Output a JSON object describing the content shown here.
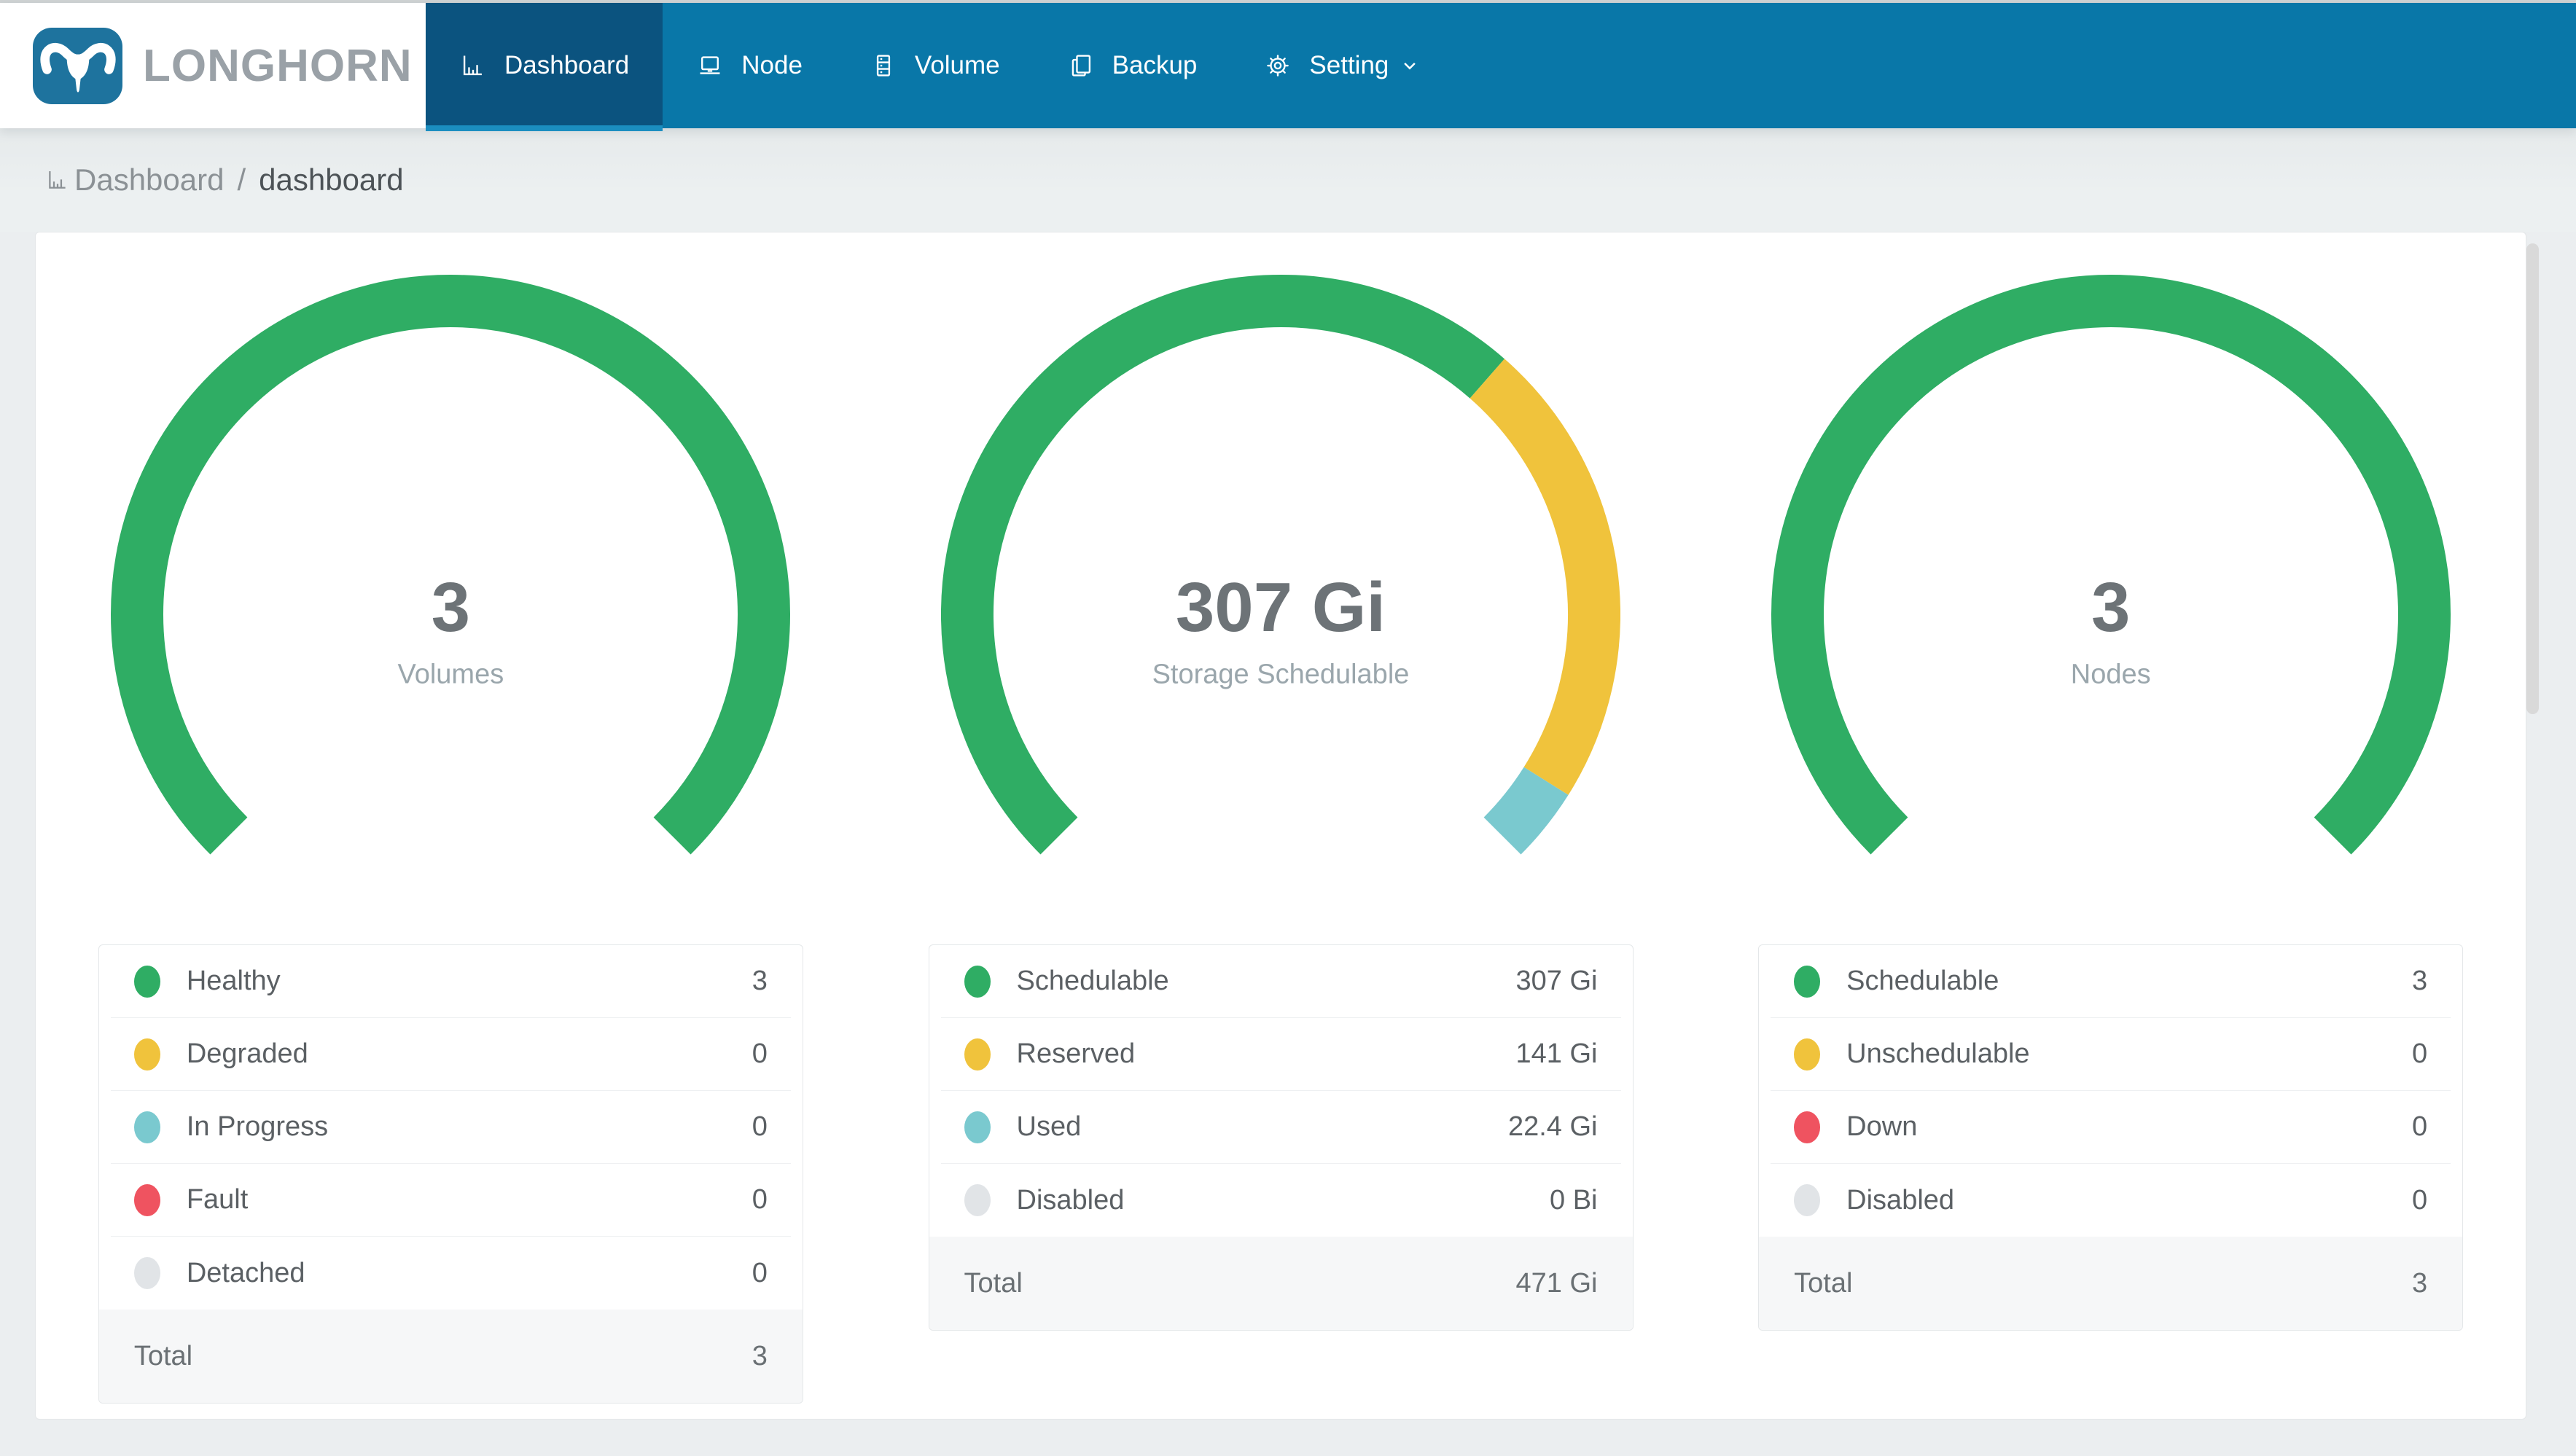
{
  "header": {
    "brand": "LONGHORN",
    "nav_items": [
      {
        "id": "dashboard",
        "label": "Dashboard",
        "icon": "bar-chart-icon",
        "active": true,
        "dropdown": false
      },
      {
        "id": "node",
        "label": "Node",
        "icon": "node-icon",
        "active": false,
        "dropdown": false
      },
      {
        "id": "volume",
        "label": "Volume",
        "icon": "volume-icon",
        "active": false,
        "dropdown": false
      },
      {
        "id": "backup",
        "label": "Backup",
        "icon": "backup-icon",
        "active": false,
        "dropdown": false
      },
      {
        "id": "setting",
        "label": "Setting",
        "icon": "gear-icon",
        "active": false,
        "dropdown": true
      }
    ]
  },
  "breadcrumb": {
    "root": "Dashboard",
    "separator": "/",
    "current": "dashboard"
  },
  "colors": {
    "nav_bar": "#0977a8",
    "nav_active": "#0b537f",
    "nav_active_underline": "#1b8ec0",
    "logo_blue": "#1e739e",
    "green": "#2fad64",
    "yellow": "#f0c33c",
    "teal": "#7ac9cf",
    "red": "#ef5360",
    "gray": "#e1e4e7"
  },
  "chart_data": [
    {
      "type": "donut-gauge",
      "id": "volumes",
      "center_value": "3",
      "center_label": "Volumes",
      "gauge": {
        "start_deg": 225,
        "sweep_deg": 270
      },
      "legend": [
        {
          "label": "Healthy",
          "amount": 3,
          "value": "3",
          "color": "green"
        },
        {
          "label": "Degraded",
          "amount": 0,
          "value": "0",
          "color": "yellow"
        },
        {
          "label": "In Progress",
          "amount": 0,
          "value": "0",
          "color": "teal"
        },
        {
          "label": "Fault",
          "amount": 0,
          "value": "0",
          "color": "red"
        },
        {
          "label": "Detached",
          "amount": 0,
          "value": "0",
          "color": "gray"
        }
      ],
      "total_label": "Total",
      "total_value": "3"
    },
    {
      "type": "donut-gauge",
      "id": "storage",
      "center_value": "307 Gi",
      "center_label": "Storage Schedulable",
      "gauge": {
        "start_deg": 225,
        "sweep_deg": 270
      },
      "legend": [
        {
          "label": "Schedulable",
          "amount": 307,
          "value": "307 Gi",
          "color": "green"
        },
        {
          "label": "Reserved",
          "amount": 141,
          "value": "141 Gi",
          "color": "yellow"
        },
        {
          "label": "Used",
          "amount": 22.4,
          "value": "22.4 Gi",
          "color": "teal"
        },
        {
          "label": "Disabled",
          "amount": 0,
          "value": "0 Bi",
          "color": "gray"
        }
      ],
      "total_label": "Total",
      "total_value": "471 Gi"
    },
    {
      "type": "donut-gauge",
      "id": "nodes",
      "center_value": "3",
      "center_label": "Nodes",
      "gauge": {
        "start_deg": 225,
        "sweep_deg": 270
      },
      "legend": [
        {
          "label": "Schedulable",
          "amount": 3,
          "value": "3",
          "color": "green"
        },
        {
          "label": "Unschedulable",
          "amount": 0,
          "value": "0",
          "color": "yellow"
        },
        {
          "label": "Down",
          "amount": 0,
          "value": "0",
          "color": "red"
        },
        {
          "label": "Disabled",
          "amount": 0,
          "value": "0",
          "color": "gray"
        }
      ],
      "total_label": "Total",
      "total_value": "3"
    }
  ]
}
